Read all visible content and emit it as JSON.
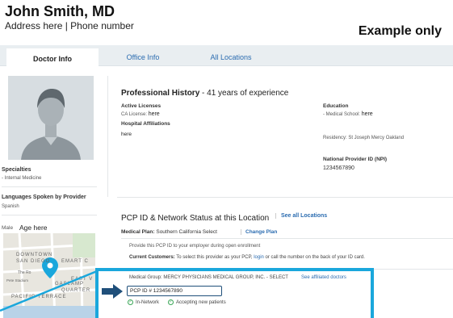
{
  "header": {
    "name": "John Smith, MD",
    "subtitle": "Address here | Phone number",
    "badge": "Example only"
  },
  "tabs": [
    {
      "label": "Doctor Info",
      "active": true
    },
    {
      "label": "Office Info",
      "active": false
    },
    {
      "label": "All Locations",
      "active": false
    }
  ],
  "profile": {
    "specialties_label": "Specialties",
    "specialties_value": "- Internal Medicine",
    "languages_label": "Languages Spoken by Provider",
    "languages_value": "Spanish",
    "gender": "Male",
    "age": "Age here"
  },
  "map": {
    "labels": [
      "DOWNTOWN",
      "SAN DIEGO",
      "EMART C",
      "EAST V",
      "GASLAMP",
      "QUARTER",
      "PACIFIC TERRACE",
      "The Ro",
      "Pete Stadium"
    ]
  },
  "history": {
    "title": "Professional History",
    "experience": " - 41 years of experience",
    "licenses_label": "Active Licenses",
    "licenses_value_prefix": "CA License: ",
    "licenses_value": "here",
    "affiliations_label": "Hospital Affiliations",
    "affiliations_value": "here",
    "education_label": "Education",
    "education_value_prefix": "- Medical School: ",
    "education_value": "here",
    "residency": "Residency: St Joseph Mercy Oakland",
    "npi_label": "National Provider ID (NPI)",
    "npi_value": "1234567890"
  },
  "pcp": {
    "title": "PCP ID & Network Status at this Location",
    "see_all": "See all Locations",
    "medical_plan_label": "Medical Plan:",
    "medical_plan_value": "Southern California Select",
    "change_plan": "Change Plan",
    "info_line": "Provide this PCP ID to your employer during open enrollment",
    "current_label": "Current Customers:",
    "current_text_a": "To select this provider as your PCP, ",
    "login": "login",
    "current_text_b": " or call the number on the back of your ID card.",
    "medical_group": "Medical Group: MERCY PHYSICIANS MEDICAL GROUP, INC. - SELECT",
    "see_affiliated": "See affiliated doctors",
    "pcp_id": "PCP ID # 1234567890",
    "in_network": "In-Network",
    "accepting": "Accepting new patients"
  },
  "colors": {
    "accent": "#1aa7dc",
    "link": "#2b6cb0",
    "check": "#3aa657"
  }
}
